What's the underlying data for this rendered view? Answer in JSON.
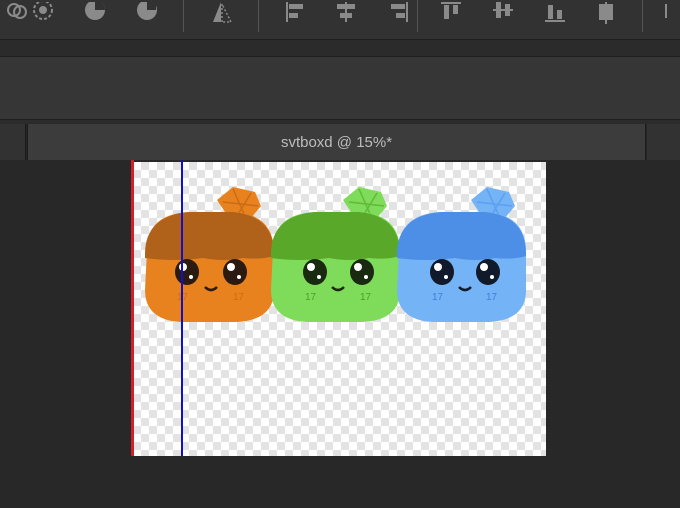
{
  "document": {
    "tab_title": "svtboxd @ 15%*"
  },
  "toolbar": {
    "icons": [
      "shape-intersect-icon",
      "shape-exclude-icon",
      "shape-subtract-icon",
      "shape-combine-icon",
      "transform-warp-icon",
      "align-left-icon",
      "align-horizontal-center-icon",
      "align-right-icon",
      "align-top-icon",
      "align-vertical-center-icon",
      "align-bottom-icon",
      "distribute-icon"
    ]
  },
  "artwork": {
    "characters": [
      {
        "name": "orange",
        "cap": "#b0621b",
        "body": "#e8821e",
        "leaf": "#e8821e",
        "accent": "#c96c16"
      },
      {
        "name": "green",
        "cap": "#5aa82a",
        "body": "#7fdc5a",
        "leaf": "#7fdc5a",
        "accent": "#63b83b"
      },
      {
        "name": "blue",
        "cap": "#4d8fe6",
        "body": "#74b3f5",
        "leaf": "#74b3f5",
        "accent": "#5b9ff0"
      }
    ],
    "cheek_text": "17"
  },
  "colors": {
    "guide_red": "#d0202a",
    "guide_blue": "#1010c8"
  }
}
